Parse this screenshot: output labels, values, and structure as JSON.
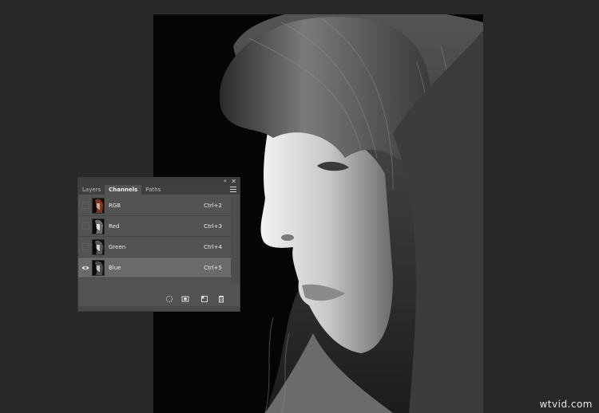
{
  "panel": {
    "tabs": [
      {
        "label": "Layers"
      },
      {
        "label": "Channels"
      },
      {
        "label": "Paths"
      }
    ],
    "channels": [
      {
        "name": "RGB",
        "shortcut": "Ctrl+2",
        "visible": false
      },
      {
        "name": "Red",
        "shortcut": "Ctrl+3",
        "visible": false
      },
      {
        "name": "Green",
        "shortcut": "Ctrl+4",
        "visible": false
      },
      {
        "name": "Blue",
        "shortcut": "Ctrl+5",
        "visible": true
      }
    ],
    "collapse_glyph": "«",
    "close_glyph": "✕"
  },
  "footer_icons": [
    "load-selection-icon",
    "save-selection-icon",
    "new-channel-icon",
    "delete-channel-icon"
  ],
  "watermark": "wtvid.com",
  "colors": {
    "panel": "#535353",
    "selected_row": "#6a6a6a",
    "background": "#282828"
  }
}
